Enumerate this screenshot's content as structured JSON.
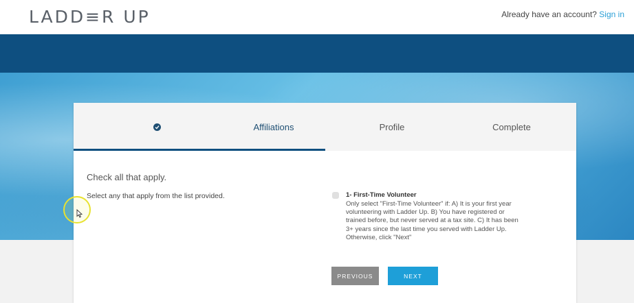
{
  "header": {
    "logo": "LADD≡R UP",
    "signin_prompt": "Already have an account?",
    "signin_link": "Sign in"
  },
  "steps": [
    {
      "label": "",
      "icon": "check-circle-icon",
      "state": "done"
    },
    {
      "label": "Affiliations",
      "state": "active"
    },
    {
      "label": "Profile",
      "state": "pending"
    },
    {
      "label": "Complete",
      "state": "pending"
    }
  ],
  "form": {
    "heading": "Check all that apply.",
    "instructions": "Select any that apply from the list provided.",
    "option": {
      "title": "1- First-Time Volunteer",
      "description": "Only select \"First-Time Volunteer\" if: A) It is your first year volunteering with Ladder Up. B) You have registered or trained before, but never served at a tax site. C) It has been 3+ years since the last time you served with Ladder Up. Otherwise, click \"Next\"",
      "checked": false
    },
    "previous_label": "PREVIOUS",
    "next_label": "NEXT"
  },
  "colors": {
    "nav_band": "#0e4f80",
    "accent": "#1e9fd8",
    "step_active": "#1f4f73",
    "prev_button": "#8a8a8a"
  }
}
